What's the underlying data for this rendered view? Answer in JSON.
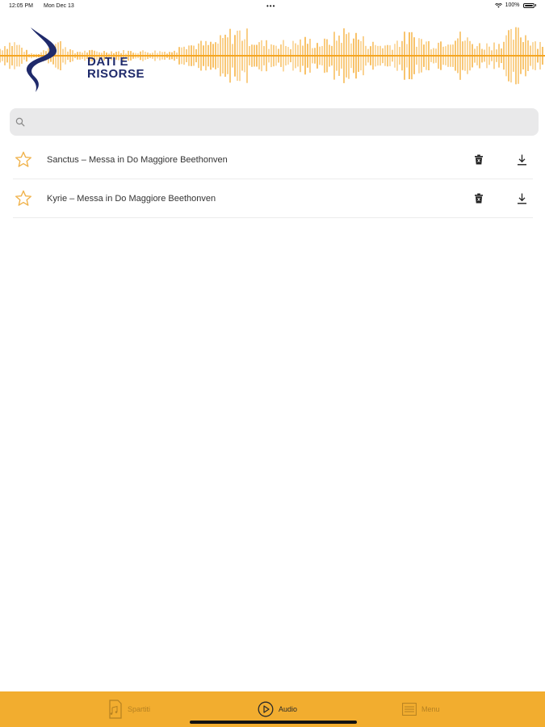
{
  "status_bar": {
    "time": "12:05 PM",
    "date": "Mon Dec 13",
    "dots": "•••",
    "battery_percent": "100%",
    "icons": [
      "wifi-icon",
      "battery-icon"
    ]
  },
  "header": {
    "brand_line1": "DATI E",
    "brand_line2": "RISORSE",
    "wave_color": "#f5a623",
    "brand_color": "#1f2a6b"
  },
  "search": {
    "placeholder": "",
    "value": "",
    "icon": "search-icon"
  },
  "tracks": [
    {
      "title": "Sanctus – Messa in Do Maggiore Beethonven",
      "favorite": false
    },
    {
      "title": "Kyrie – Messa in Do Maggiore Beethonven",
      "favorite": false
    }
  ],
  "tab_bar": {
    "background": "#f2ad2f",
    "tabs": [
      {
        "label": "Spartiti",
        "icon": "sheet-music-icon",
        "active": false
      },
      {
        "label": "Audio",
        "icon": "play-circle-icon",
        "active": true
      },
      {
        "label": "Menu",
        "icon": "menu-icon",
        "active": false
      }
    ]
  },
  "colors": {
    "accent": "#f5a623",
    "star": "#f0b24a",
    "icon": "#222222"
  }
}
